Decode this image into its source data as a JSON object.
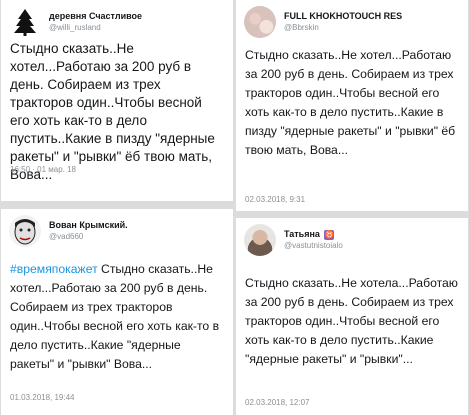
{
  "tweets": [
    {
      "display_name": "деревня Счастливое",
      "handle": "@willi_rusland",
      "text": "Стыдно сказать..Не хотел...Работаю за 200 руб в день. Собираем из трех тракторов один..Чтобы весной его хоть как-то в дело пустить..Какие в пизду \"ядерные ракеты\" и \"рывки\" ёб твою мать, Вова...",
      "time": "16:50 · 01 мар. 18"
    },
    {
      "display_name": "FULL KHOKHOTOUCH RES",
      "handle": "@Bbrskin",
      "text": "Стыдно сказать..Не хотел...Работаю за 200 руб в день. Собираем из трех  тракторов один..Чтобы весной его хоть как-то в дело пустить..Какие в  пизду \"ядерные ракеты\" и \"рывки\" ёб твою мать, Вова...",
      "time": "02.03.2018, 9:31"
    },
    {
      "display_name": "Вован Крымский.",
      "handle": "@vad660",
      "hashtag": "#времяпокажет",
      "text": " Стыдно сказать..Не хотел...Работаю за 200 руб в день. Собираем из трех тракторов один..Чтобы весной его хоть как-то в дело пустить..Какие \"ядерные ракеты\" и \"рывки\"  Вова...",
      "time": "01.03.2018, 19:44"
    },
    {
      "display_name": "Татьяна",
      "badge": "♉",
      "handle": "@vastutnistoialo",
      "text": "Стыдно сказать..Не хотела...Работаю за 200 руб в день. Собираем из трех  тракторов один..Чтобы весной его хоть как-то в дело пустить..Какие  \"ядерные ракеты\" и \"рывки\"...",
      "time": "02.03.2018, 12:07"
    }
  ]
}
